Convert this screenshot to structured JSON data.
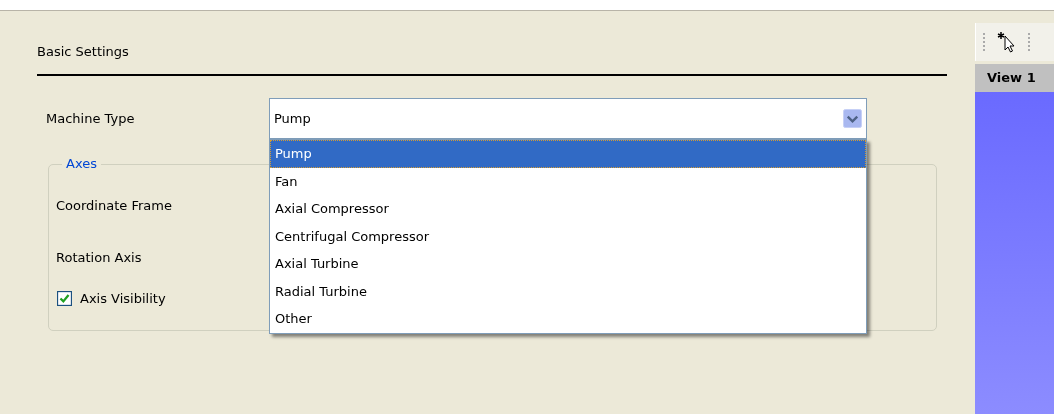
{
  "section": {
    "title": "Basic Settings"
  },
  "machine_type": {
    "label": "Machine Type",
    "value": "Pump",
    "expanded": true,
    "options": [
      {
        "label": "Pump",
        "selected": true
      },
      {
        "label": "Fan",
        "selected": false
      },
      {
        "label": "Axial Compressor",
        "selected": false
      },
      {
        "label": "Centrifugal Compressor",
        "selected": false
      },
      {
        "label": "Axial Turbine",
        "selected": false
      },
      {
        "label": "Radial Turbine",
        "selected": false
      },
      {
        "label": "Other",
        "selected": false
      }
    ]
  },
  "axes_group": {
    "title": "Axes",
    "fields": [
      {
        "label": "Coordinate Frame"
      },
      {
        "label": "Rotation Axis"
      }
    ],
    "checkbox": {
      "label": "Axis Visibility",
      "checked": true
    }
  },
  "viewer": {
    "title": "View 1"
  }
}
